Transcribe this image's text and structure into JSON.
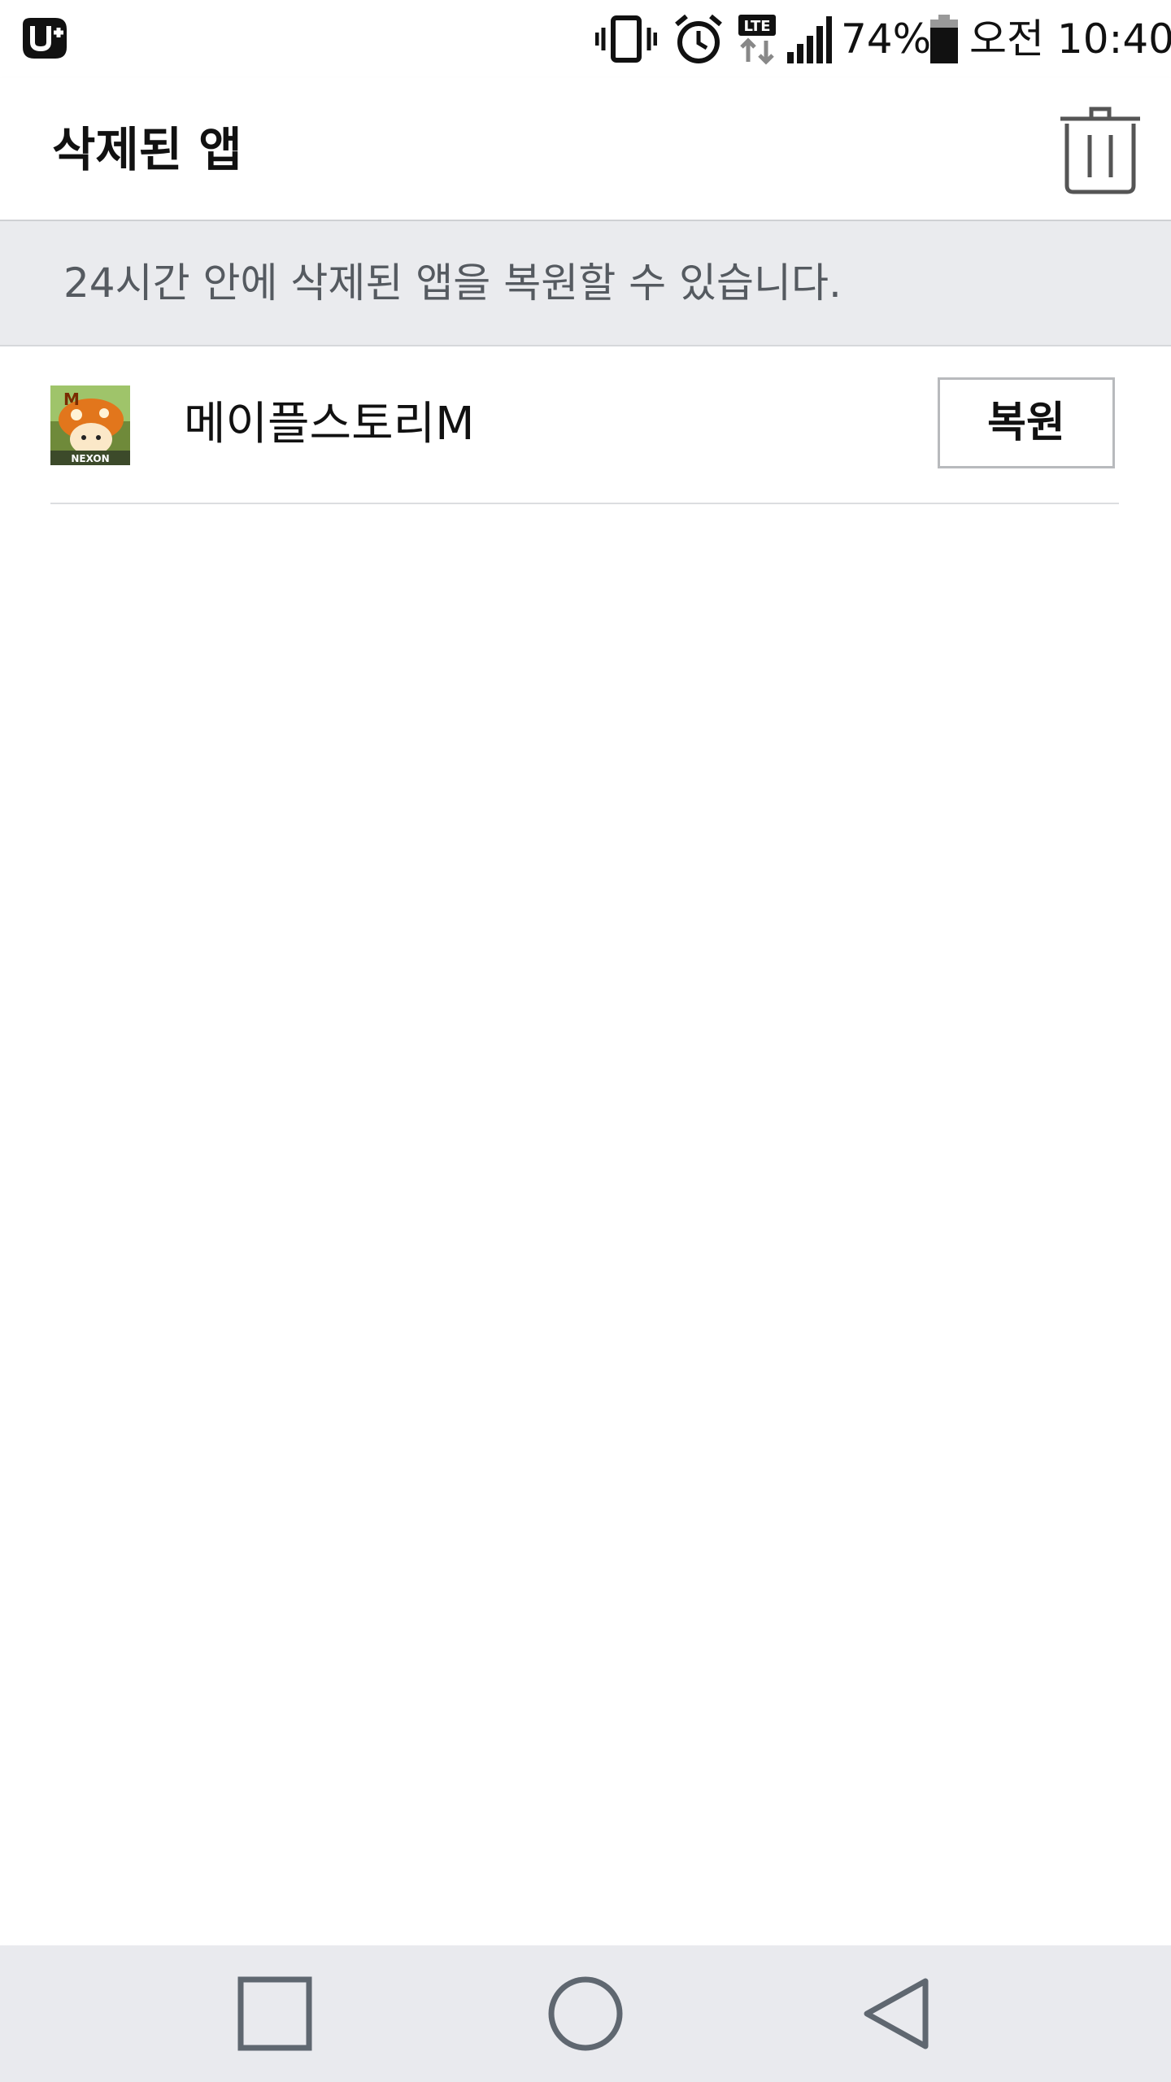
{
  "status_bar": {
    "carrier_icon": "uplus-carrier-icon",
    "network_type": "LTE",
    "battery_percent": "74%",
    "time": "오전 10:40",
    "icons": [
      "vibrate-icon",
      "alarm-icon",
      "lte-data-icon",
      "signal-icon",
      "battery-icon"
    ]
  },
  "app_bar": {
    "title": "삭제된 앱",
    "trash_icon": "trash-icon"
  },
  "banner": {
    "text": "24시간 안에 삭제된 앱을 복원할 수 있습니다."
  },
  "deleted_apps": [
    {
      "name": "메이플스토리M",
      "icon": "maplestory-m-app-icon",
      "icon_badge": "M",
      "icon_caption": "NEXON",
      "action_label": "복원"
    }
  ],
  "nav_bar": {
    "buttons": [
      "recent-apps-icon",
      "home-icon",
      "back-icon"
    ]
  },
  "colors": {
    "banner_bg": "#eaebee",
    "nav_bg": "#e9eaee",
    "banner_text": "#555a60",
    "nav_icon": "#5f6770"
  }
}
